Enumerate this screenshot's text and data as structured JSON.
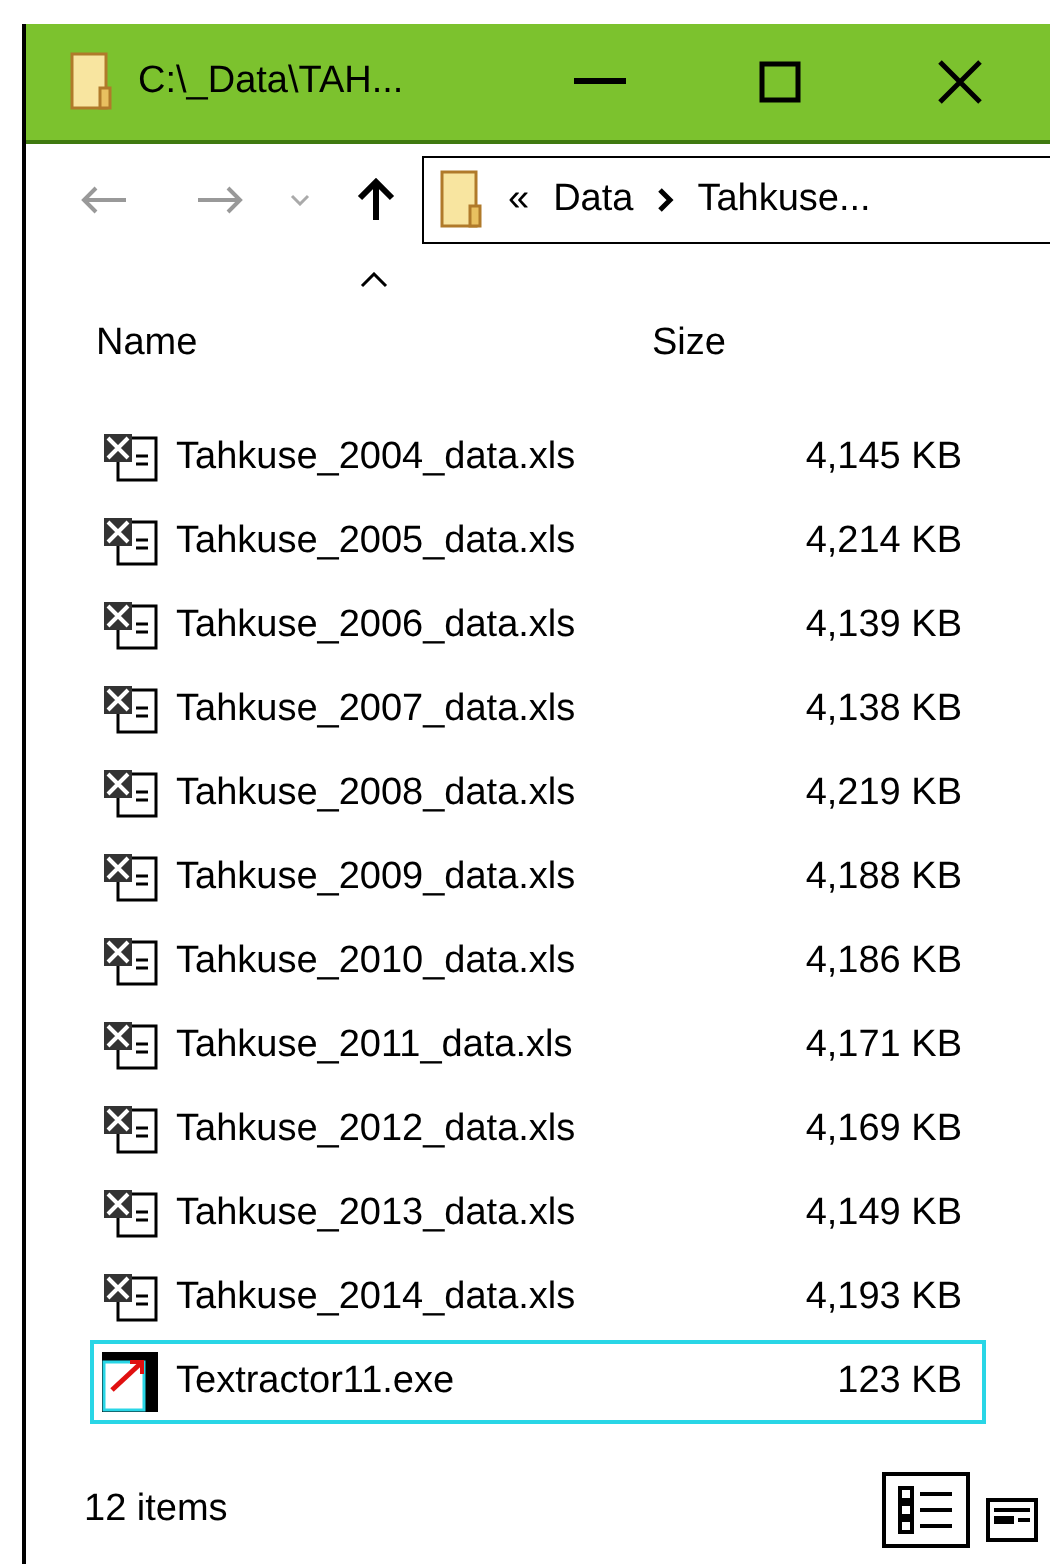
{
  "window": {
    "title": "C:\\_Data\\TAH...",
    "controls": [
      {
        "kind": "minimize"
      },
      {
        "kind": "maximize"
      },
      {
        "kind": "close"
      }
    ]
  },
  "toolbar": {
    "breadcrumb": [
      "«",
      "Data",
      "Tahkuse..."
    ]
  },
  "columns": [
    {
      "label": "Name",
      "sorted": true
    },
    {
      "label": "Size",
      "sorted": false
    }
  ],
  "files": [
    {
      "name": "Tahkuse_2004_data.xls",
      "size": "4,145 KB",
      "kind": "xls",
      "selected": false
    },
    {
      "name": "Tahkuse_2005_data.xls",
      "size": "4,214 KB",
      "kind": "xls",
      "selected": false
    },
    {
      "name": "Tahkuse_2006_data.xls",
      "size": "4,139 KB",
      "kind": "xls",
      "selected": false
    },
    {
      "name": "Tahkuse_2007_data.xls",
      "size": "4,138 KB",
      "kind": "xls",
      "selected": false
    },
    {
      "name": "Tahkuse_2008_data.xls",
      "size": "4,219 KB",
      "kind": "xls",
      "selected": false
    },
    {
      "name": "Tahkuse_2009_data.xls",
      "size": "4,188 KB",
      "kind": "xls",
      "selected": false
    },
    {
      "name": "Tahkuse_2010_data.xls",
      "size": "4,186 KB",
      "kind": "xls",
      "selected": false
    },
    {
      "name": "Tahkuse_2011_data.xls",
      "size": "4,171 KB",
      "kind": "xls",
      "selected": false
    },
    {
      "name": "Tahkuse_2012_data.xls",
      "size": "4,169 KB",
      "kind": "xls",
      "selected": false
    },
    {
      "name": "Tahkuse_2013_data.xls",
      "size": "4,149 KB",
      "kind": "xls",
      "selected": false
    },
    {
      "name": "Tahkuse_2014_data.xls",
      "size": "4,193 KB",
      "kind": "xls",
      "selected": false
    },
    {
      "name": "Textractor11.exe",
      "size": "123 KB",
      "kind": "exe",
      "selected": true
    }
  ],
  "status_bar": {
    "count": "12 items",
    "views": [
      {
        "kind": "details",
        "selected": true
      },
      {
        "kind": "preview",
        "selected": false
      }
    ]
  }
}
